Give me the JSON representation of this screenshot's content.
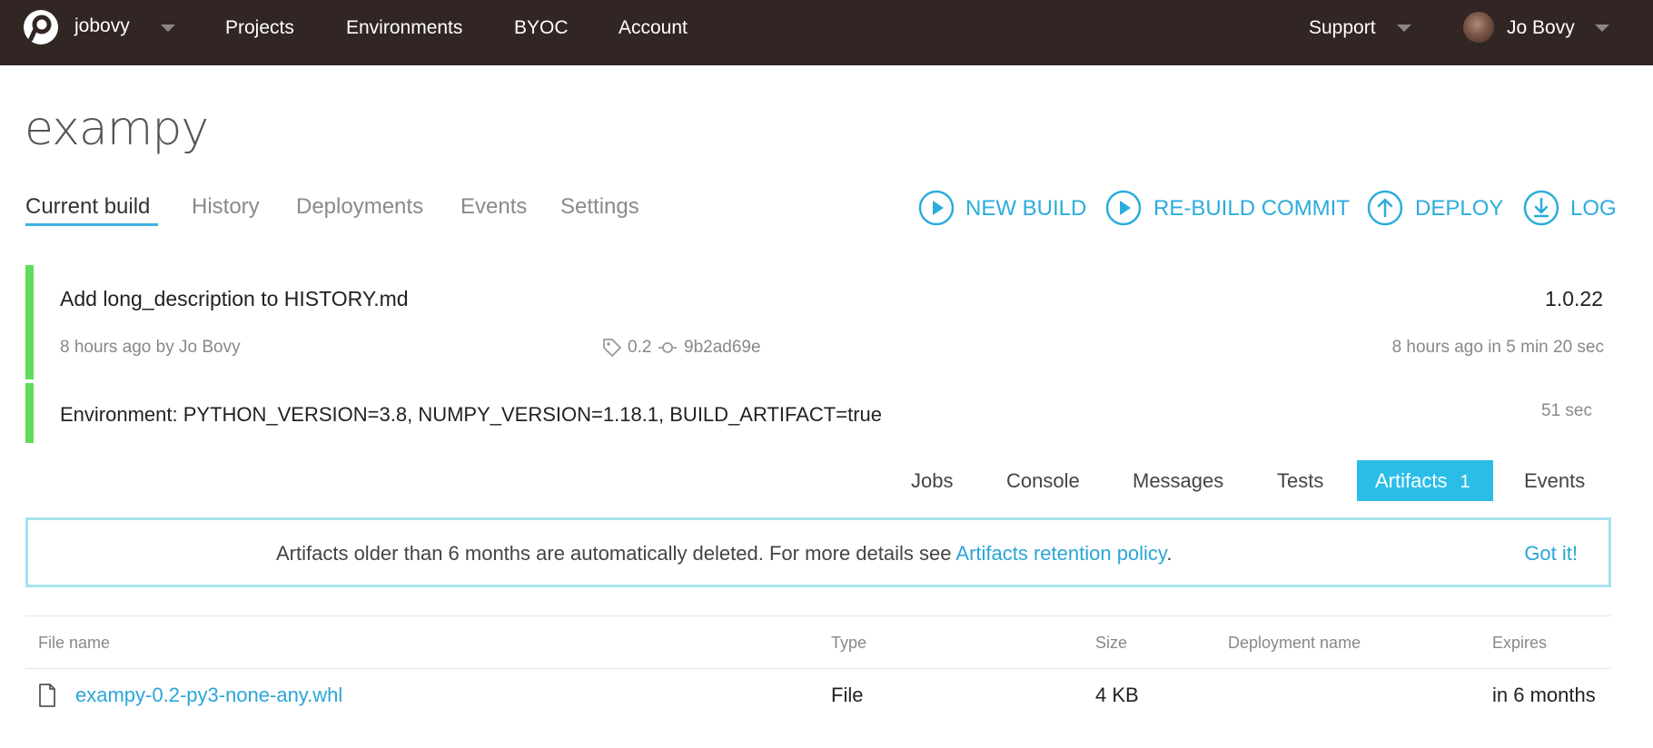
{
  "nav": {
    "account_name": "jobovy",
    "items": [
      "Projects",
      "Environments",
      "BYOC",
      "Account"
    ],
    "support_label": "Support",
    "user_name": "Jo Bovy"
  },
  "project": {
    "title": "exampy"
  },
  "tabs": [
    "Current build",
    "History",
    "Deployments",
    "Events",
    "Settings"
  ],
  "actions": {
    "new_build": "NEW BUILD",
    "rebuild_commit": "RE-BUILD COMMIT",
    "deploy": "DEPLOY",
    "log": "LOG"
  },
  "build": {
    "commit_message": "Add long_description to HISTORY.md",
    "version": "1.0.22",
    "author_line": "8 hours ago by Jo Bovy",
    "tag": "0.2",
    "commit_hash": "9b2ad69e",
    "timing": "8 hours ago in 5 min 20 sec"
  },
  "job": {
    "environment": "Environment: PYTHON_VERSION=3.8, NUMPY_VERSION=1.18.1, BUILD_ARTIFACT=true",
    "duration": "51 sec"
  },
  "subtabs": {
    "jobs": "Jobs",
    "console": "Console",
    "messages": "Messages",
    "tests": "Tests",
    "artifacts": "Artifacts",
    "artifacts_count": "1",
    "events": "Events"
  },
  "notice": {
    "text": "Artifacts older than 6 months are automatically deleted. For more details see ",
    "link": "Artifacts retention policy",
    "period": ".",
    "dismiss": "Got it!"
  },
  "table": {
    "headers": [
      "File name",
      "Type",
      "Size",
      "Deployment name",
      "Expires"
    ],
    "rows": [
      {
        "file_name": "exampy-0.2-py3-none-any.whl",
        "type": "File",
        "size": "4 KB",
        "deployment_name": "",
        "expires": "in 6 months"
      }
    ]
  },
  "colors": {
    "nav_bg": "#312624",
    "accent": "#2bacdd",
    "success": "#5fdc5c",
    "notice_border": "#a6e3ee"
  }
}
